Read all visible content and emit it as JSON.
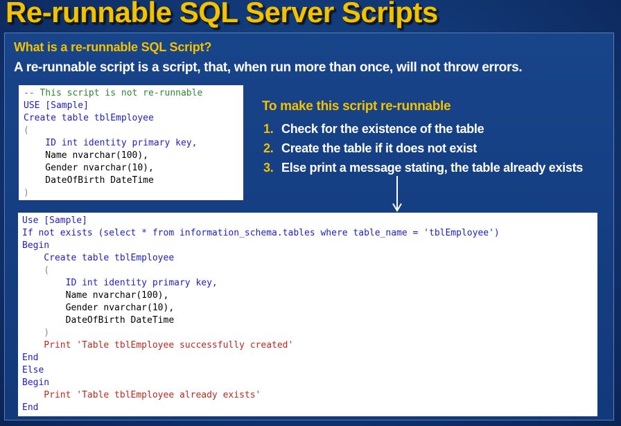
{
  "slide": {
    "title": "Re-runnable SQL Server Scripts",
    "question": "What is a re-runnable SQL Script?",
    "definition": "A re-runnable script is a script, that, when run more than once, will not throw errors.",
    "colors": {
      "title": "#f2c200",
      "background": "#123a78",
      "keyword": "#1e1ec8",
      "comment": "#2a8a2a",
      "string": "#c0281e",
      "muted": "#8a8a8a"
    }
  },
  "original_script": {
    "lines": [
      {
        "text": "-- This script is not re-runnable"
      },
      {
        "text": "USE [Sample]"
      },
      {
        "text": "Create table tblEmployee"
      },
      {
        "text": "("
      },
      {
        "text": "    ID int identity primary key,"
      },
      {
        "text": "    Name nvarchar(100),"
      },
      {
        "text": "    Gender nvarchar(10),"
      },
      {
        "text": "    DateOfBirth DateTime"
      },
      {
        "text": ")"
      }
    ]
  },
  "instructions": {
    "heading": "To make this script re-runnable",
    "steps": [
      {
        "num": "1.",
        "text": "Check for the existence of the table"
      },
      {
        "num": "2.",
        "text": "Create the table if it does not exist"
      },
      {
        "num": "3.",
        "text": "Else print a message stating, the table already exists"
      }
    ]
  },
  "rerunnable_script": {
    "lines": [
      {
        "text": "Use [Sample]"
      },
      {
        "text": "If not exists (select * from information_schema.tables where table_name = 'tblEmployee')"
      },
      {
        "text": "Begin"
      },
      {
        "text": "    Create table tblEmployee"
      },
      {
        "text": "    ("
      },
      {
        "text": "        ID int identity primary key,"
      },
      {
        "text": "        Name nvarchar(100),"
      },
      {
        "text": "        Gender nvarchar(10),"
      },
      {
        "text": "        DateOfBirth DateTime"
      },
      {
        "text": "    )"
      },
      {
        "text": "    Print 'Table tblEmployee successfully created'"
      },
      {
        "text": "End"
      },
      {
        "text": "Else"
      },
      {
        "text": "Begin"
      },
      {
        "text": "    Print 'Table tblEmployee already exists'"
      },
      {
        "text": "End"
      }
    ]
  }
}
